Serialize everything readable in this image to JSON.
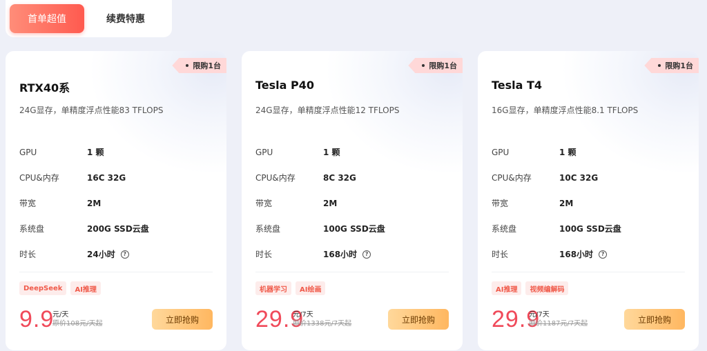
{
  "tabs": [
    {
      "label": "首单超值"
    },
    {
      "label": "续费特惠"
    }
  ],
  "cards": [
    {
      "badge": "限购1台",
      "title": "RTX40系",
      "subtitle": "24G显存，单精度浮点性能83 TFLOPS",
      "specs": [
        {
          "label": "GPU",
          "value": "1 颗"
        },
        {
          "label": "CPU&内存",
          "value": "16C 32G"
        },
        {
          "label": "带宽",
          "value": "2M"
        },
        {
          "label": "系统盘",
          "value": "200G SSD云盘"
        },
        {
          "label": "时长",
          "value": "24小时"
        }
      ],
      "tags": [
        "DeepSeek",
        "AI推理"
      ],
      "price": "9.9",
      "unit": "元/天",
      "original": "原价108元/天起",
      "buy_label": "立即抢购"
    },
    {
      "badge": "限购1台",
      "title": "Tesla P40",
      "subtitle": "24G显存，单精度浮点性能12 TFLOPS",
      "specs": [
        {
          "label": "GPU",
          "value": "1 颗"
        },
        {
          "label": "CPU&内存",
          "value": "8C 32G"
        },
        {
          "label": "带宽",
          "value": "2M"
        },
        {
          "label": "系统盘",
          "value": "100G SSD云盘"
        },
        {
          "label": "时长",
          "value": "168小时"
        }
      ],
      "tags": [
        "机器学习",
        "AI绘画"
      ],
      "price": "29.9",
      "unit": "元/7天",
      "original": "原价1338元/7天起",
      "buy_label": "立即抢购"
    },
    {
      "badge": "限购1台",
      "title": "Tesla T4",
      "subtitle": "16G显存，单精度浮点性能8.1 TFLOPS",
      "specs": [
        {
          "label": "GPU",
          "value": "1 颗"
        },
        {
          "label": "CPU&内存",
          "value": "10C 32G"
        },
        {
          "label": "带宽",
          "value": "2M"
        },
        {
          "label": "系统盘",
          "value": "100G SSD云盘"
        },
        {
          "label": "时长",
          "value": "168小时"
        }
      ],
      "tags": [
        "AI推理",
        "视频编解码"
      ],
      "price": "29.9",
      "unit": "元/7天",
      "original": "原价1187元/7天起",
      "buy_label": "立即抢购"
    }
  ],
  "colors": {
    "tab_active": "#ff5a4f",
    "price": "#f04a5a",
    "tag_text": "#f05a4a",
    "buy_button": "#ffb760"
  },
  "icons": {
    "duration_help": "question-circle-icon"
  }
}
